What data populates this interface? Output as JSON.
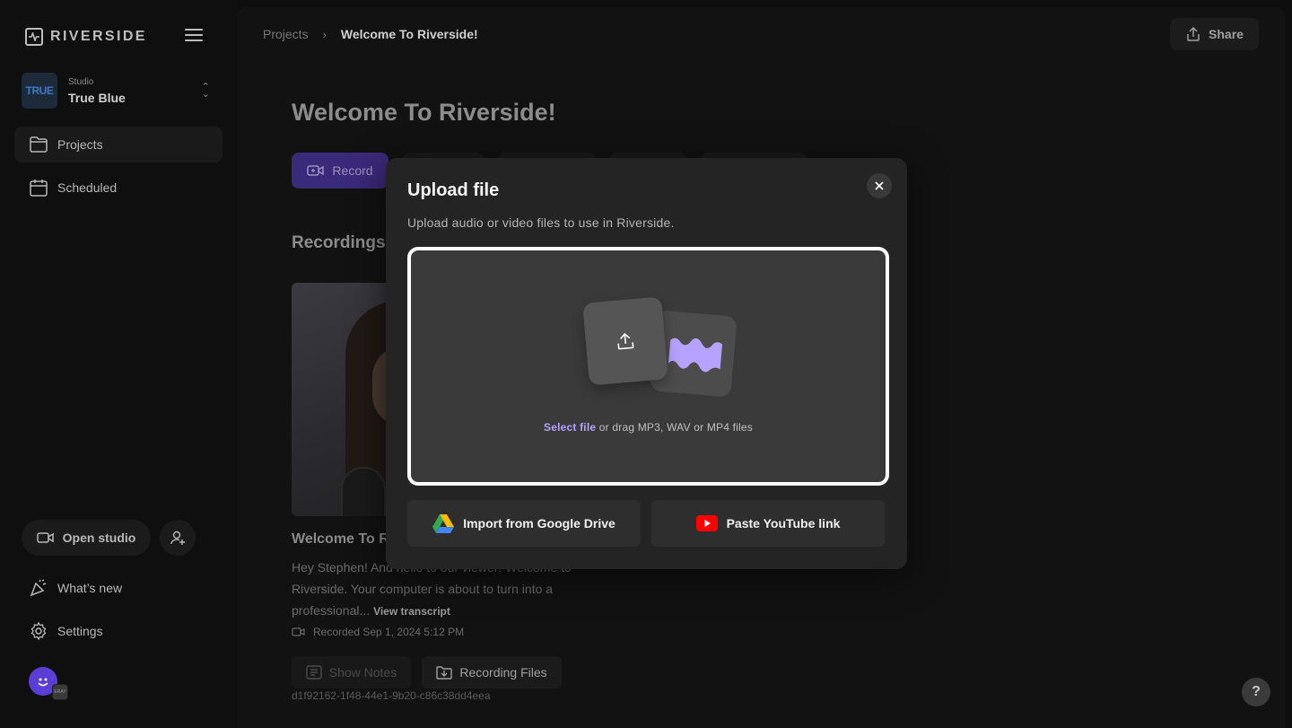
{
  "brand": {
    "name": "RIVERSIDE"
  },
  "studio": {
    "label": "Studio",
    "name": "True Blue",
    "thumb_text": "TRUE"
  },
  "sidebar": {
    "items": [
      {
        "label": "Projects",
        "icon": "folder-icon"
      },
      {
        "label": "Scheduled",
        "icon": "calendar-icon"
      }
    ],
    "open_studio_label": "Open studio",
    "whats_new_label": "What’s new",
    "settings_label": "Settings",
    "avatar_badge": "ERAY"
  },
  "breadcrumb": {
    "parent": "Projects",
    "current": "Welcome To Riverside!"
  },
  "header": {
    "share_label": "Share"
  },
  "page": {
    "title": "Welcome To Riverside!",
    "record_label": "Record",
    "section_title": "Recordings"
  },
  "recording": {
    "title": "Welcome To Riverside!",
    "description": "Hey Stephen! And hello to our viewer! Welcome to Riverside. Your computer is about to turn into a professional...",
    "view_transcript": "View transcript",
    "recorded": "Recorded Sep 1, 2024 5:12 PM",
    "show_notes": "Show Notes",
    "recording_files": "Recording Files",
    "id": "d1f92162-1f48-44e1-9b20-c86c38dd4eea"
  },
  "modal": {
    "title": "Upload file",
    "subtitle": "Upload audio or video files to use in Riverside.",
    "select_file": "Select file",
    "drag_text": " or drag MP3, WAV or MP4 files",
    "google_drive_label": "Import from Google Drive",
    "youtube_label": "Paste YouTube link"
  },
  "help": {
    "label": "?"
  },
  "colors": {
    "accent": "#b6a2ff",
    "record": "#3a2a7a",
    "youtube": "#ff0000"
  }
}
